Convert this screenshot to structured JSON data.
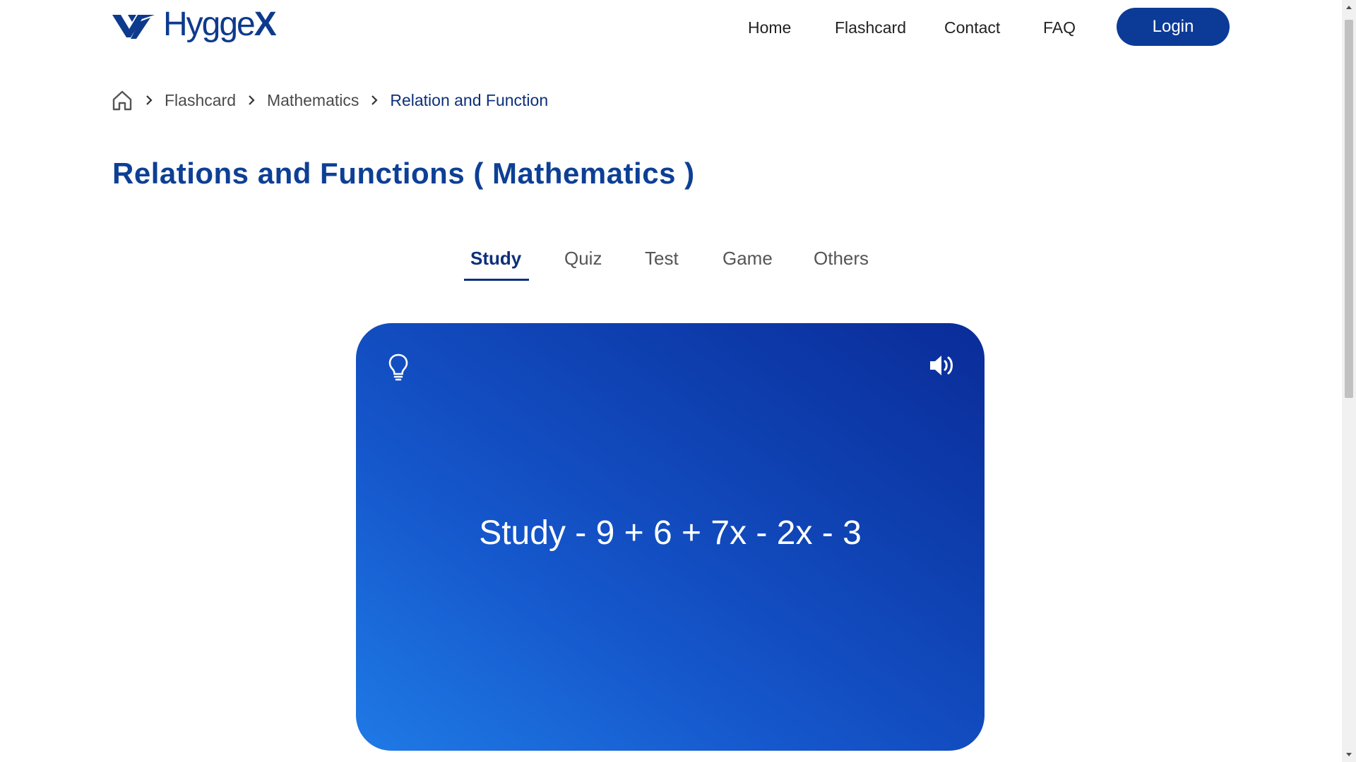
{
  "header": {
    "logo_text_main": "Hygge",
    "logo_text_accent": "X",
    "nav": {
      "home": "Home",
      "flashcard": "Flashcard",
      "contact": "Contact",
      "faq": "FAQ"
    },
    "login_label": "Login"
  },
  "breadcrumb": {
    "home_icon": "home-icon",
    "items": [
      "Flashcard",
      "Mathematics",
      "Relation and Function"
    ]
  },
  "page_title": "Relations and Functions ( Mathematics )",
  "tabs": {
    "active": "Study",
    "items": [
      "Study",
      "Quiz",
      "Test",
      "Game",
      "Others"
    ]
  },
  "card": {
    "text": "Study - 9 + 6 + 7x - 2x - 3",
    "hint_icon": "lightbulb-icon",
    "sound_icon": "speaker-icon"
  },
  "colors": {
    "brand": "#0c3b97",
    "title": "#0d3f95",
    "card_gradient_start": "#1f7ae6",
    "card_gradient_end": "#0a2c98"
  }
}
